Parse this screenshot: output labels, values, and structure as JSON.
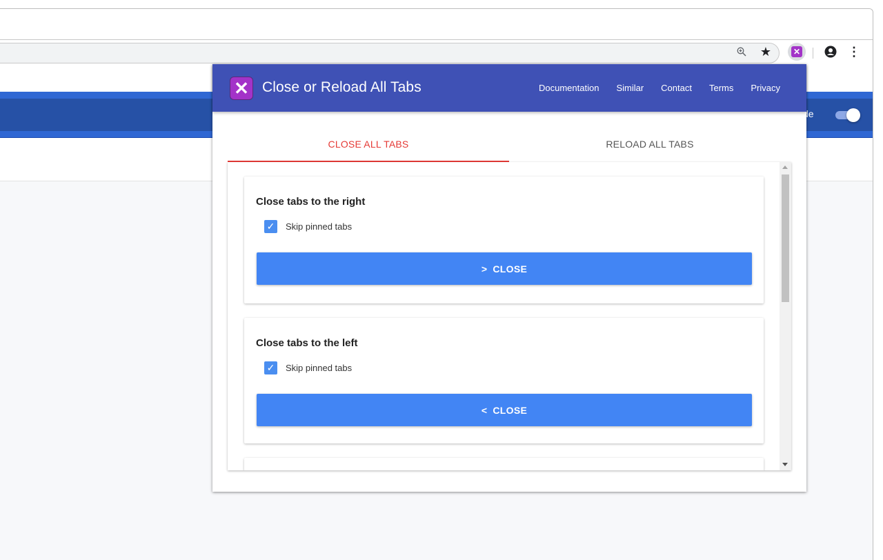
{
  "browser": {
    "toolbar_icons": [
      "zoom-icon",
      "star-icon",
      "extension-close-reload-icon",
      "account-icon",
      "menu-icon"
    ]
  },
  "page": {
    "mode_label": "de",
    "mode_toggle_on": true
  },
  "popup": {
    "title": "Close or Reload All Tabs",
    "nav": [
      "Documentation",
      "Similar",
      "Contact",
      "Terms",
      "Privacy"
    ],
    "tabs": [
      {
        "label": "CLOSE ALL TABS",
        "active": true
      },
      {
        "label": "RELOAD ALL TABS",
        "active": false
      }
    ],
    "colors": {
      "header": "#3f51b5",
      "active_tab": "#e53935",
      "button": "#4285f4",
      "logo": "#a333c8"
    },
    "cards": [
      {
        "title": "Close tabs to the right",
        "checkbox_label": "Skip pinned tabs",
        "checked": true,
        "button_icon": ">",
        "button_label": "CLOSE"
      },
      {
        "title": "Close tabs to the left",
        "checkbox_label": "Skip pinned tabs",
        "checked": true,
        "button_icon": "<",
        "button_label": "CLOSE"
      }
    ]
  }
}
